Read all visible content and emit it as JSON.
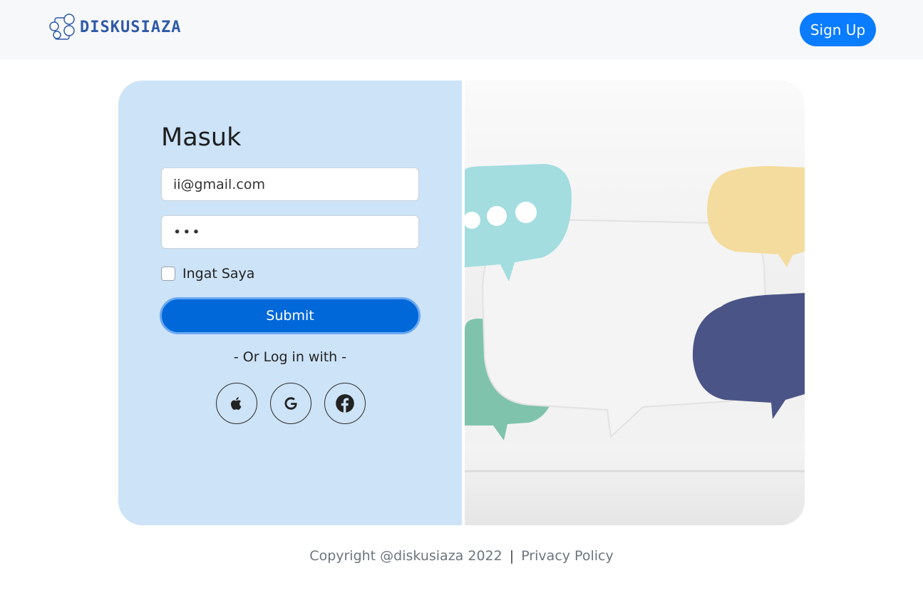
{
  "navbar": {
    "brand_text": "DISKUSIAZA",
    "signup_label": "Sign Up"
  },
  "login": {
    "title": "Masuk",
    "email_value": "ii@gmail.com",
    "password_value": "•••",
    "remember_label": "Ingat Saya",
    "submit_label": "Submit",
    "alt_login_text": "- Or Log in with -",
    "social_icons": [
      "apple-icon",
      "google-icon",
      "facebook-icon"
    ]
  },
  "footer": {
    "copyright": "Copyright @diskusiaza 2022",
    "separator": "|",
    "privacy": "Privacy Policy"
  },
  "colors": {
    "accent": "#0a7cff",
    "submit": "#0068d9",
    "panel": "#cde3f7"
  }
}
